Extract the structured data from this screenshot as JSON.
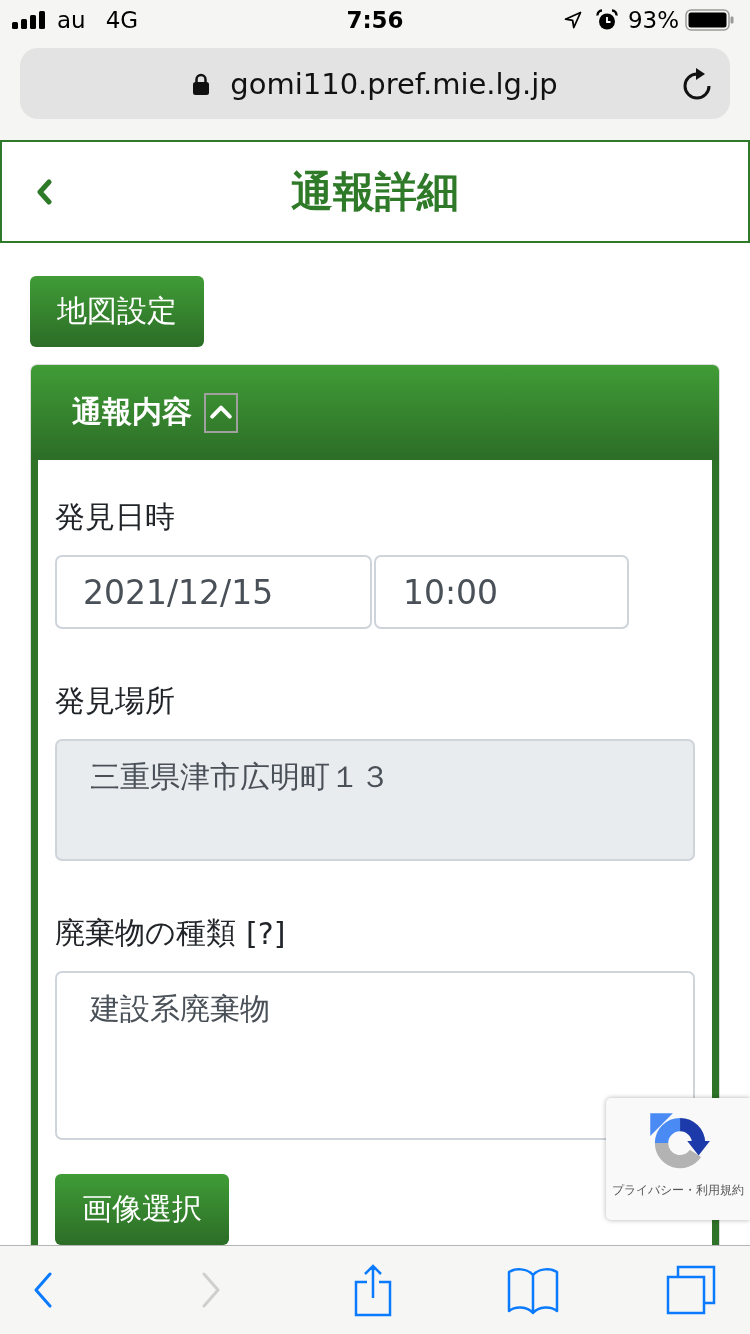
{
  "status_bar": {
    "carrier": "au",
    "network": "4G",
    "time": "7:56",
    "battery": "93%"
  },
  "address_bar": {
    "url": "gomi110.pref.mie.lg.jp"
  },
  "header": {
    "title": "通報詳細"
  },
  "map_settings_button": {
    "label": "地図設定"
  },
  "panel": {
    "title": "通報内容",
    "expanded": true,
    "fields": [
      {
        "kind": "datetime",
        "label": "発見日時",
        "date": "2021/12/15",
        "time": "10:00",
        "disabled": false
      },
      {
        "kind": "textarea",
        "label": "発見場所",
        "value": "三重県津市広明町１３",
        "disabled": true
      },
      {
        "kind": "textarea",
        "label": "廃棄物の種類",
        "help": "[?]",
        "value": "建設系廃棄物",
        "disabled": false
      }
    ],
    "image_button": {
      "label": "画像選択"
    }
  },
  "recaptcha_badge": {
    "text": "プライバシー・利用規約"
  },
  "toolbar": {
    "items": [
      {
        "kind": "back",
        "disabled": false
      },
      {
        "kind": "forward",
        "disabled": true
      },
      {
        "kind": "share",
        "disabled": false
      },
      {
        "kind": "bookmarks",
        "disabled": false
      },
      {
        "kind": "tabs",
        "disabled": false
      }
    ]
  }
}
